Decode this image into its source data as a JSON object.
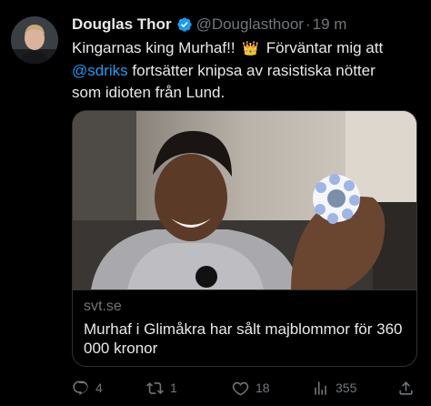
{
  "author": {
    "display_name": "Douglas Thor",
    "handle": "@Douglasthoor",
    "separator": "·",
    "timestamp": "19 m",
    "verified_icon": "verified-badge-icon"
  },
  "tweet": {
    "line1": "Kingarnas king Murhaf!!",
    "crown": "👑",
    "line1_tail": "Förväntar mig att",
    "mention": "@sdriks",
    "line2_tail": "fortsätter knipsa av rasistiska nötter",
    "line3": "som idioten från Lund."
  },
  "link_card": {
    "domain": "svt.se",
    "title": "Murhaf i Glimåkra har sålt majblommor för 360 000 kronor"
  },
  "actions": {
    "reply_count": "4",
    "retweet_count": "1",
    "like_count": "18",
    "views_count": "355"
  },
  "colors": {
    "accent": "#1d9bf0",
    "muted": "#71767b",
    "text": "#e7e9ea",
    "bg": "#000000"
  }
}
